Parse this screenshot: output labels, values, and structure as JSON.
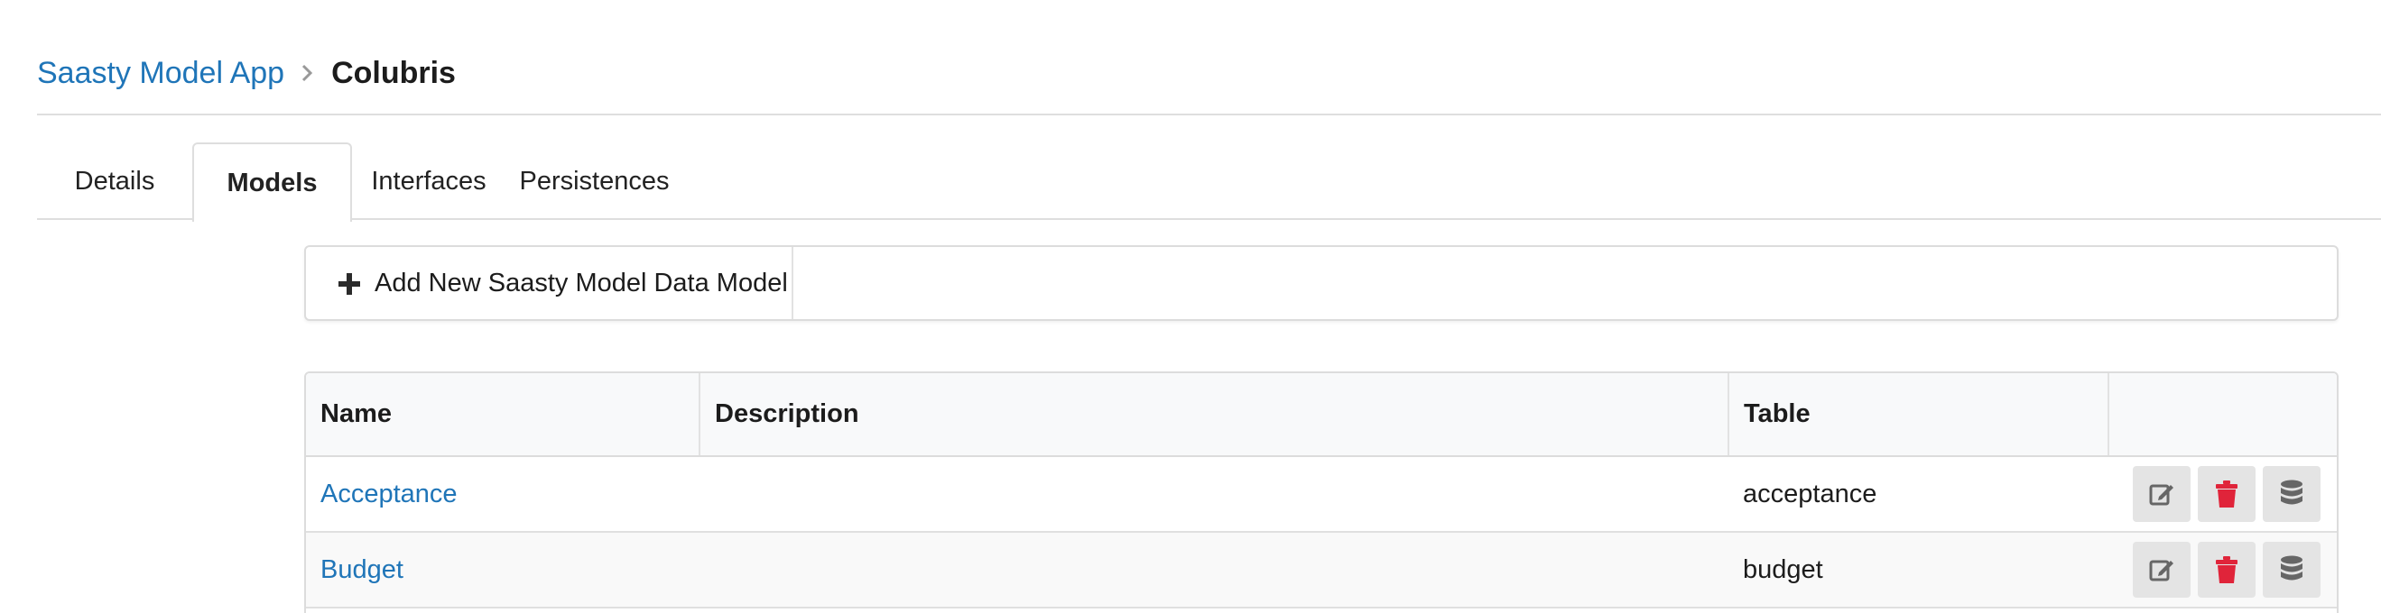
{
  "breadcrumb": {
    "parent": "Saasty Model App",
    "current": "Colubris",
    "separator_icon": "chevron-right-icon"
  },
  "tabs": [
    {
      "label": "Details",
      "active": false
    },
    {
      "label": "Models",
      "active": true
    },
    {
      "label": "Interfaces",
      "active": false
    },
    {
      "label": "Persistences",
      "active": false
    }
  ],
  "toolbar": {
    "add_label": "Add New Saasty Model Data Model",
    "add_icon": "plus-icon"
  },
  "table": {
    "columns": [
      "Name",
      "Description",
      "Table",
      ""
    ],
    "rows": [
      {
        "name": "Acceptance",
        "description": "",
        "table": "acceptance"
      },
      {
        "name": "Budget",
        "description": "",
        "table": "budget"
      }
    ],
    "row_actions": [
      "edit-icon",
      "trash-icon",
      "database-icon"
    ]
  },
  "colors": {
    "link": "#1f75b8",
    "danger": "#e0243a",
    "icon_gray": "#666666",
    "border": "#dcdcdc",
    "action_bg": "#e4e4e4"
  }
}
